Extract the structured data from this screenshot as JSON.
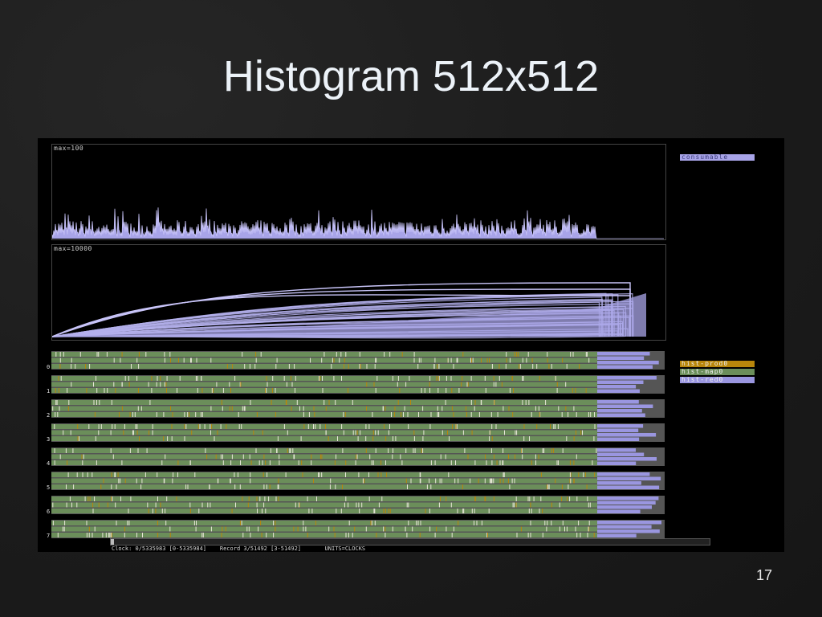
{
  "slide": {
    "title": "Histogram 512x512",
    "page_number": "17"
  },
  "panels": {
    "top_label": "max=100",
    "mid_label": "max=10000"
  },
  "legend": {
    "consumable": {
      "label": "consumable",
      "color": "#a8a4e8"
    },
    "prod": {
      "label": "hist-prod0",
      "color": "#b8860b"
    },
    "map": {
      "label": "hist-map0",
      "color": "#6b8e5a"
    },
    "red": {
      "label": "hist-red0",
      "color": "#9a96e0"
    }
  },
  "lanes": [
    {
      "label": "0"
    },
    {
      "label": "1"
    },
    {
      "label": "2"
    },
    {
      "label": "3"
    },
    {
      "label": "4"
    },
    {
      "label": "5"
    },
    {
      "label": "6"
    },
    {
      "label": "7"
    }
  ],
  "status": {
    "clock": "Clock: 0/5335983 [0-5335984]",
    "record": "Record 3/51492 [3-51492]",
    "units": "UNITS=CLOCKS"
  },
  "scroll": {
    "position": 0
  }
}
